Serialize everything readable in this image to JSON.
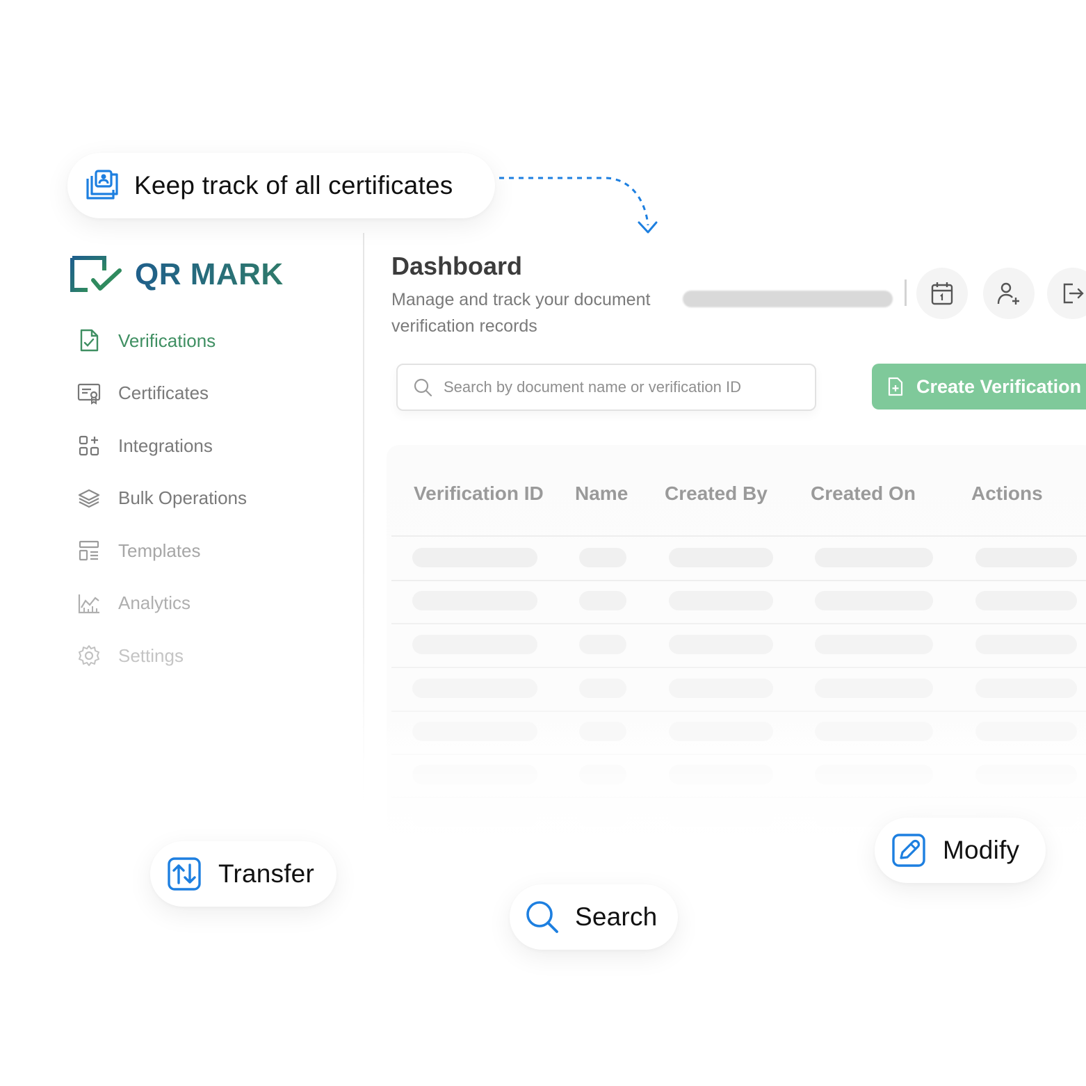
{
  "brand": {
    "name": "QR MARK",
    "accent": "#3f8f62",
    "logo_blue": "#1f5f8b"
  },
  "callouts": {
    "track": {
      "label": "Keep track of all certificates",
      "icon": "certificate-folder-icon"
    },
    "transfer": {
      "label": "Transfer",
      "icon": "transfer-arrows-icon"
    },
    "search": {
      "label": "Search",
      "icon": "search-icon"
    },
    "modify": {
      "label": "Modify",
      "icon": "edit-pencil-icon"
    },
    "icon_color": "#1d7fe0"
  },
  "sidebar": {
    "items": [
      {
        "label": "Verifications",
        "icon": "file-check-icon",
        "active": true
      },
      {
        "label": "Certificates",
        "icon": "certificate-icon"
      },
      {
        "label": "Integrations",
        "icon": "grid-plus-icon"
      },
      {
        "label": "Bulk Operations",
        "icon": "layers-icon"
      },
      {
        "label": "Templates",
        "icon": "template-icon"
      },
      {
        "label": "Analytics",
        "icon": "chart-icon"
      },
      {
        "label": "Settings",
        "icon": "gear-icon"
      }
    ]
  },
  "header": {
    "title": "Dashboard",
    "subtitle": "Manage and track your document verification records",
    "icons": [
      "calendar-icon",
      "add-user-icon",
      "logout-icon"
    ]
  },
  "toolbar": {
    "search_placeholder": "Search by document name or verification ID",
    "create_label": "Create Verification",
    "create_color": "#7fc99a"
  },
  "table": {
    "columns": [
      "Verification ID",
      "Name",
      "Created By",
      "Created On",
      "Actions"
    ]
  }
}
